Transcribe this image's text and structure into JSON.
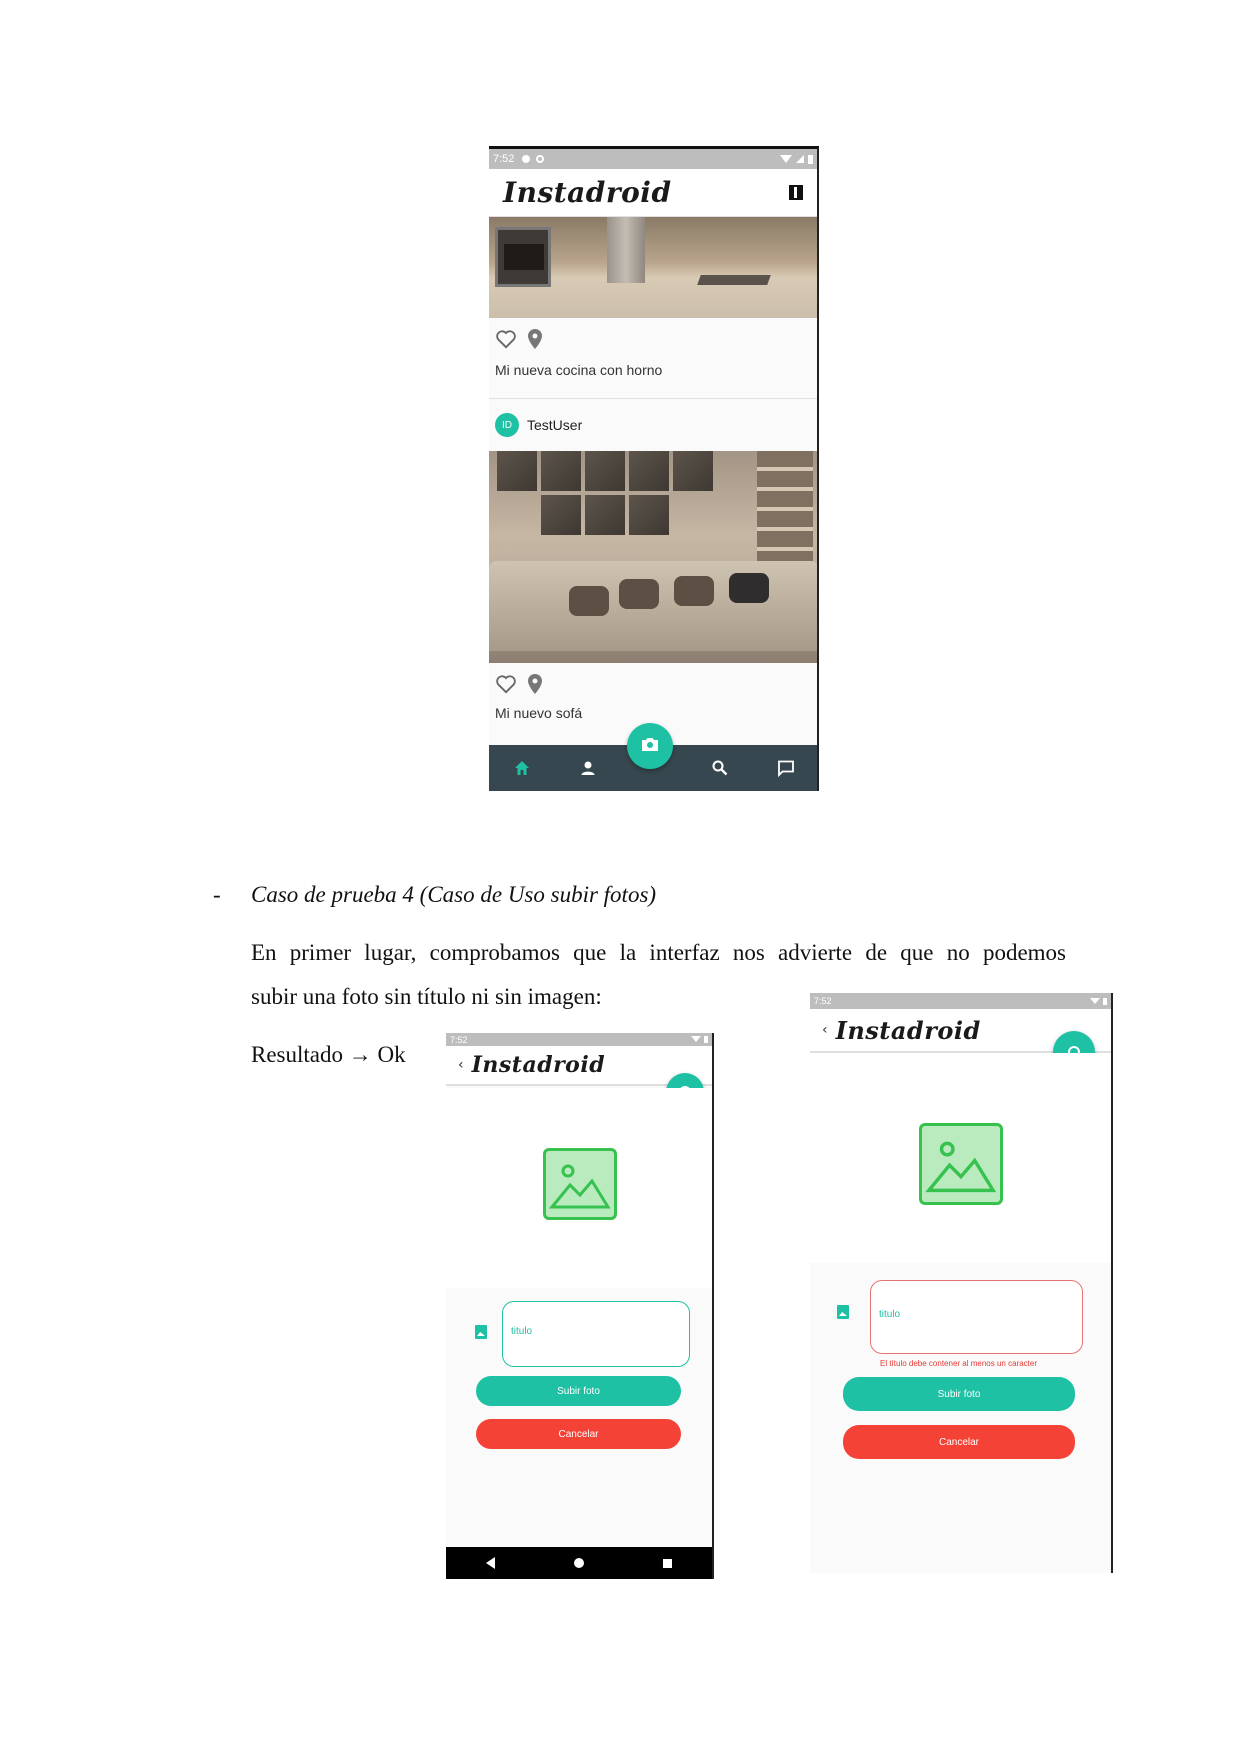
{
  "feed_screen": {
    "status_time": "7:52",
    "app_title": "Instadroid",
    "posts": [
      {
        "caption": "Mi nueva cocina con horno"
      },
      {
        "username": "TestUser",
        "avatar_initials": "ID",
        "caption": "Mi nuevo sofá"
      }
    ],
    "icons": [
      "map-icon",
      "heart-icon",
      "location-pin-icon",
      "home-icon",
      "profile-icon",
      "camera-icon",
      "search-icon",
      "chat-icon"
    ]
  },
  "document": {
    "bullet": "-",
    "heading": "Caso de prueba 4 (Caso de Uso subir fotos)",
    "paragraph_line1": "En primer lugar, comprobamos que la interfaz nos advierte de que no podemos",
    "paragraph_line2": "subir una foto sin título ni sin imagen:",
    "result": "Resultado → Ok"
  },
  "upload_screen_1": {
    "status_time": "7:52",
    "app_title": "Instadroid",
    "title_placeholder": "titulo",
    "submit_label": "Subir foto",
    "cancel_label": "Cancelar"
  },
  "upload_screen_2": {
    "status_time": "7:52",
    "app_title": "Instadroid",
    "title_placeholder": "titulo",
    "error_message": "El título debe contener al menos un caracter",
    "submit_label": "Subir foto",
    "cancel_label": "Cancelar"
  },
  "colors": {
    "accent": "#1ec1a4",
    "danger": "#f44336",
    "navbar": "#37474f"
  }
}
